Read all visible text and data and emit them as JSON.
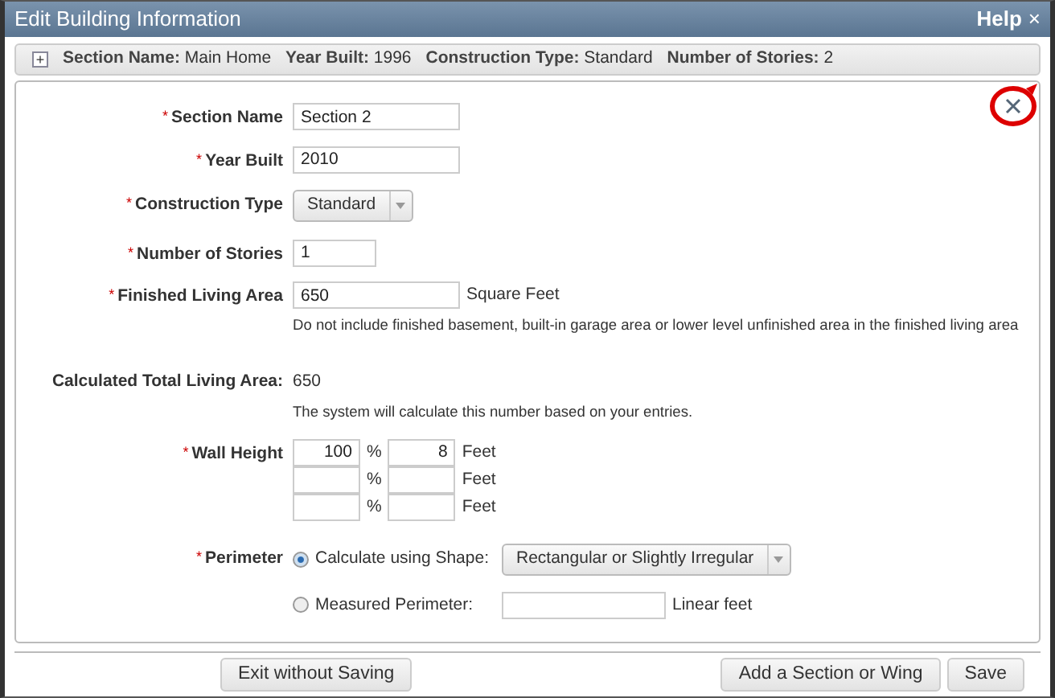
{
  "window": {
    "title": "Edit Building Information",
    "help": "Help",
    "close": "×"
  },
  "summary_toggle": "+",
  "summary": [
    {
      "label": "Section Name:",
      "value": "Main Home"
    },
    {
      "label": "Year Built:",
      "value": "1996"
    },
    {
      "label": "Construction Type:",
      "value": "Standard"
    },
    {
      "label": "Number of Stories:",
      "value": "2"
    }
  ],
  "fields": [
    {
      "kind": "text",
      "label": "Section Name",
      "required_mark": "*",
      "value": "Section 2"
    },
    {
      "kind": "text",
      "label": "Year Built",
      "required_mark": "*",
      "value": "2010"
    },
    {
      "kind": "select",
      "label": "Construction Type",
      "required_mark": "*",
      "value": "Standard"
    },
    {
      "kind": "text",
      "label": "Number of Stories",
      "required_mark": "*",
      "value": "1"
    },
    {
      "kind": "text",
      "label": "Finished Living Area",
      "required_mark": "*",
      "value": "650",
      "suffix": "Square Feet",
      "note": "Do not include finished basement, built-in garage area or lower level unfinished area in the finished living area"
    },
    {
      "kind": "readout",
      "label": "Calculated Total Living Area:",
      "value": "650",
      "note": "The system will calculate this number based on your entries."
    },
    {
      "kind": "walls",
      "label": "Wall Height",
      "required_mark": "*",
      "rows": [
        {
          "percent": "100",
          "percent_unit": "%",
          "feet": "8",
          "feet_unit": "Feet"
        },
        {
          "percent_unit": "%",
          "feet_unit": "Feet"
        },
        {
          "percent_unit": "%",
          "feet_unit": "Feet"
        }
      ]
    },
    {
      "kind": "radios",
      "label": "Perimeter",
      "required_mark": "*",
      "options": [
        {
          "label": "Calculate using Shape:",
          "selected": true,
          "kind": "select",
          "value": "Rectangular or Slightly Irregular"
        },
        {
          "label": "Measured Perimeter:",
          "selected": false,
          "kind": "text",
          "suffix": "Linear feet"
        }
      ]
    }
  ],
  "buttons": [
    {
      "label": "Exit without Saving"
    },
    {
      "label": "Add a Section or Wing"
    },
    {
      "label": "Save"
    }
  ]
}
